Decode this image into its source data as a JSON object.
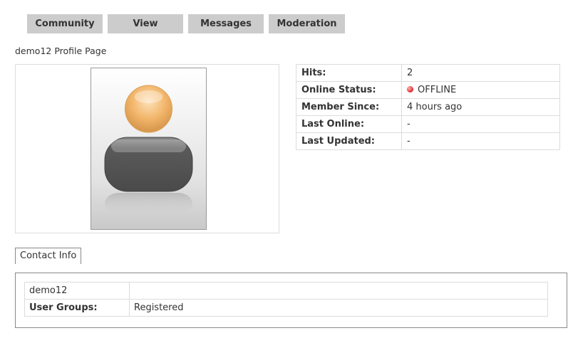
{
  "nav": {
    "tabs": [
      {
        "label": "Community"
      },
      {
        "label": "View"
      },
      {
        "label": "Messages"
      },
      {
        "label": "Moderation"
      }
    ]
  },
  "profile": {
    "title": "demo12 Profile Page"
  },
  "stats": [
    {
      "label": "Hits:",
      "value": "2"
    },
    {
      "label": "Online Status:",
      "value": "OFFLINE",
      "icon": "offline-status-icon",
      "color": "#c0392b"
    },
    {
      "label": "Member Since:",
      "value": "4 hours ago"
    },
    {
      "label": "Last Online:",
      "value": "-"
    },
    {
      "label": "Last Updated:",
      "value": "-"
    }
  ],
  "contact": {
    "tab_label": "Contact Info",
    "rows": [
      {
        "label": "demo12",
        "value": ""
      },
      {
        "label": "User Groups:",
        "value": "Registered"
      }
    ]
  },
  "avatar": {
    "icon": "default-user-avatar-icon"
  },
  "colors": {
    "tab_bg": "#cccccc",
    "offline": "#c0392b",
    "avatar_head": "#f2b66b",
    "avatar_body": "#5e5e5e"
  }
}
